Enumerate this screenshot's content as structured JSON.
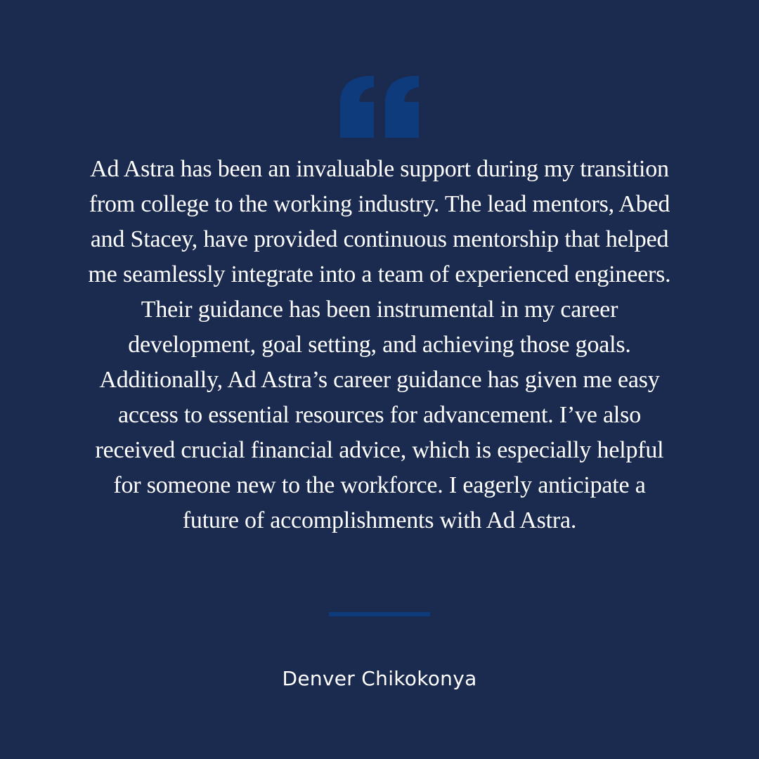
{
  "colors": {
    "background": "#1b2a4f",
    "accent": "#0d3b7c",
    "text": "#ffffff"
  },
  "quote_icon": "opening-quotation-mark-icon",
  "testimonial": {
    "text": "Ad Astra has been an invaluable support during my transition from college to the working industry. The lead mentors, Abed and Stacey, have provided continuous mentorship that helped me seamlessly integrate into a team of experienced engineers. Their guidance has been instrumental in my career development, goal setting, and achieving those goals. Additionally, Ad Astra’s career guidance has given me easy access to essential resources for advancement. I’ve also received crucial financial advice, which is especially helpful for someone new to the workforce. I eagerly anticipate a future of accomplishments with Ad Astra.",
    "author": "Denver Chikokonya"
  }
}
